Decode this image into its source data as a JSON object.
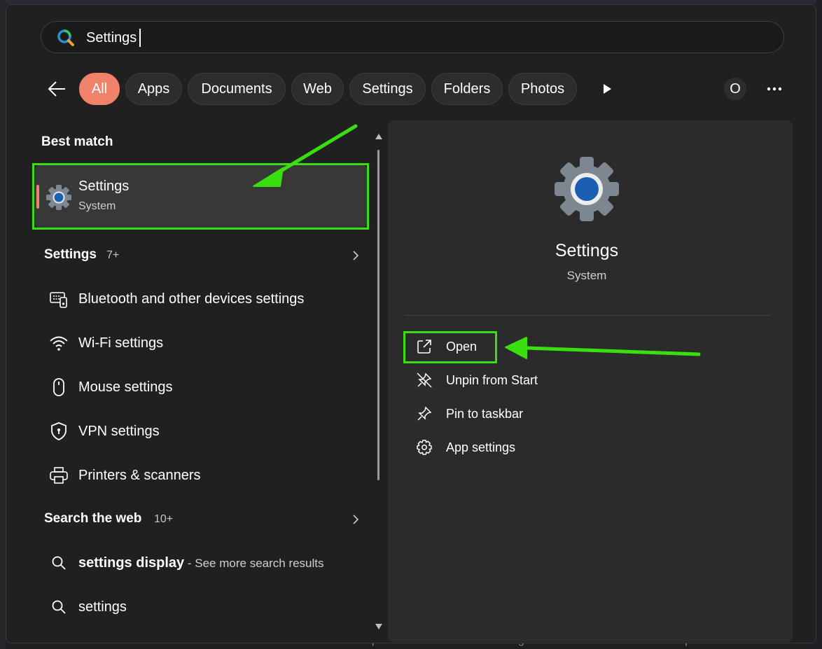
{
  "background": {
    "footer_text": "ChatGPT peut faire des erreurs. Envisagez de vérifier les informations importantes."
  },
  "search": {
    "value": "Settings",
    "icon": "search-logo-icon"
  },
  "filters": {
    "back_icon": "back-arrow-icon",
    "chips": [
      {
        "label": "All",
        "active": true
      },
      {
        "label": "Apps"
      },
      {
        "label": "Documents"
      },
      {
        "label": "Web"
      },
      {
        "label": "Settings"
      },
      {
        "label": "Folders"
      },
      {
        "label": "Photos"
      }
    ],
    "avatar_letter": "O",
    "play_icon": "play-icon",
    "more_icon": "more-icon"
  },
  "results": {
    "best_match_title": "Best match",
    "best_match": {
      "title": "Settings",
      "subtitle": "System",
      "icon": "settings-gear-icon"
    },
    "settings_section": {
      "title": "Settings",
      "count": "7+"
    },
    "settings_items": [
      {
        "label": "Bluetooth and other devices settings",
        "icon": "devices-icon"
      },
      {
        "label": "Wi-Fi settings",
        "icon": "wifi-icon"
      },
      {
        "label": "Mouse settings",
        "icon": "mouse-icon"
      },
      {
        "label": "VPN settings",
        "icon": "shield-icon"
      },
      {
        "label": "Printers & scanners",
        "icon": "printer-icon"
      }
    ],
    "web_section": {
      "title": "Search the web",
      "count": "10+"
    },
    "web_items": [
      {
        "query": "settings display",
        "hint": " - See more search results",
        "icon": "search-icon"
      },
      {
        "query": "settings",
        "icon": "search-icon"
      }
    ]
  },
  "detail": {
    "title": "Settings",
    "subtitle": "System",
    "actions": [
      {
        "label": "Open",
        "icon": "open-external-icon"
      },
      {
        "label": "Unpin from Start",
        "icon": "unpin-icon"
      },
      {
        "label": "Pin to taskbar",
        "icon": "pin-icon"
      },
      {
        "label": "App settings",
        "icon": "gear-icon"
      }
    ]
  },
  "colors": {
    "accent": "#f0826a",
    "annotation": "#3adf0f",
    "panel": "#2b2b2b",
    "background": "#202020"
  }
}
